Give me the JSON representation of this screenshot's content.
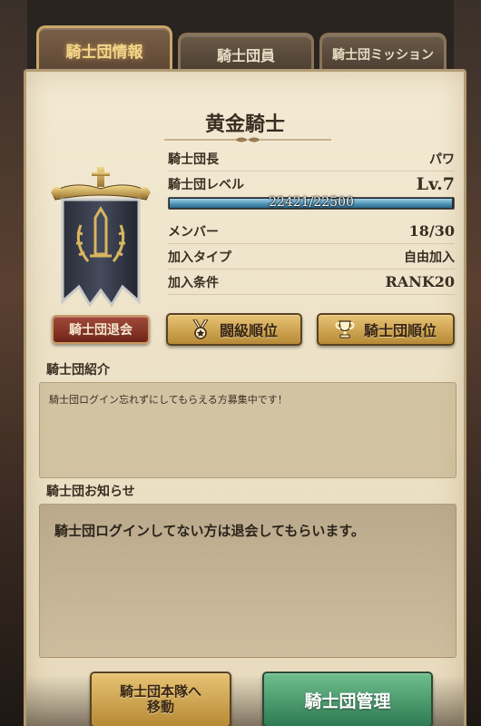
{
  "tabs": [
    {
      "label": "騎士団情報",
      "active": true
    },
    {
      "label": "騎士団員",
      "active": false
    },
    {
      "label": "騎士団ミッション",
      "active": false
    }
  ],
  "guild": {
    "name": "黄金騎士",
    "emblem": "sword-laurel-banner-icon"
  },
  "info": {
    "leader_label": "騎士団長",
    "leader_value": "パワ",
    "level_label": "騎士団レベル",
    "level_value": "Lv.7",
    "xp_text": "22421/22500",
    "xp_progress": 0.9965,
    "members_label": "メンバー",
    "members_value": "18/30",
    "join_type_label": "加入タイプ",
    "join_type_value": "自由加入",
    "join_cond_label": "加入条件",
    "join_cond_value": "RANK20"
  },
  "buttons": {
    "leave": "騎士団退会",
    "rank_battle": "闘級順位",
    "rank_guild": "騎士団順位",
    "move_line1": "騎士団本隊へ",
    "move_line2": "移動",
    "manage": "騎士団管理"
  },
  "intro": {
    "label": "騎士団紹介",
    "text": "騎士団ログイン忘れずにしてもらえる方募集中です！"
  },
  "notice": {
    "label": "騎士団お知らせ",
    "text": "騎士団ログインしてない方は退会してもらいます。"
  },
  "colors": {
    "parchment": "#efe4c9",
    "gold_button": "#d4a853",
    "green_button": "#4a9a6a",
    "leave_button": "#8a3428",
    "xp_bar": "#5aa0c4"
  }
}
